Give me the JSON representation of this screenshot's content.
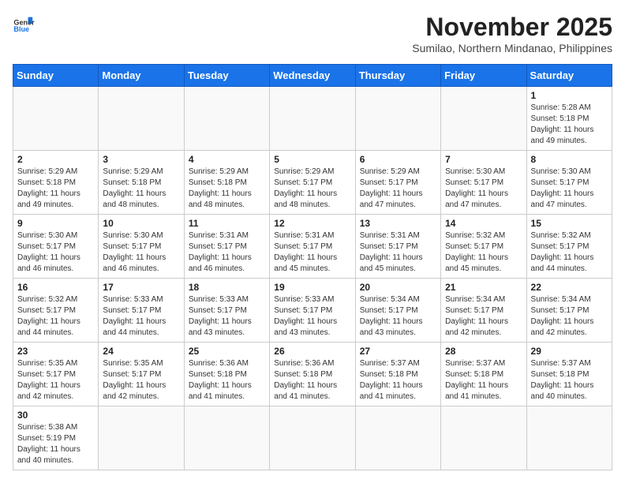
{
  "header": {
    "logo_general": "General",
    "logo_blue": "Blue",
    "month_title": "November 2025",
    "subtitle": "Sumilao, Northern Mindanao, Philippines"
  },
  "weekdays": [
    "Sunday",
    "Monday",
    "Tuesday",
    "Wednesday",
    "Thursday",
    "Friday",
    "Saturday"
  ],
  "weeks": [
    [
      {
        "day": "",
        "content": ""
      },
      {
        "day": "",
        "content": ""
      },
      {
        "day": "",
        "content": ""
      },
      {
        "day": "",
        "content": ""
      },
      {
        "day": "",
        "content": ""
      },
      {
        "day": "",
        "content": ""
      },
      {
        "day": "1",
        "content": "Sunrise: 5:28 AM\nSunset: 5:18 PM\nDaylight: 11 hours and 49 minutes."
      }
    ],
    [
      {
        "day": "2",
        "content": "Sunrise: 5:29 AM\nSunset: 5:18 PM\nDaylight: 11 hours and 49 minutes."
      },
      {
        "day": "3",
        "content": "Sunrise: 5:29 AM\nSunset: 5:18 PM\nDaylight: 11 hours and 48 minutes."
      },
      {
        "day": "4",
        "content": "Sunrise: 5:29 AM\nSunset: 5:18 PM\nDaylight: 11 hours and 48 minutes."
      },
      {
        "day": "5",
        "content": "Sunrise: 5:29 AM\nSunset: 5:17 PM\nDaylight: 11 hours and 48 minutes."
      },
      {
        "day": "6",
        "content": "Sunrise: 5:29 AM\nSunset: 5:17 PM\nDaylight: 11 hours and 47 minutes."
      },
      {
        "day": "7",
        "content": "Sunrise: 5:30 AM\nSunset: 5:17 PM\nDaylight: 11 hours and 47 minutes."
      },
      {
        "day": "8",
        "content": "Sunrise: 5:30 AM\nSunset: 5:17 PM\nDaylight: 11 hours and 47 minutes."
      }
    ],
    [
      {
        "day": "9",
        "content": "Sunrise: 5:30 AM\nSunset: 5:17 PM\nDaylight: 11 hours and 46 minutes."
      },
      {
        "day": "10",
        "content": "Sunrise: 5:30 AM\nSunset: 5:17 PM\nDaylight: 11 hours and 46 minutes."
      },
      {
        "day": "11",
        "content": "Sunrise: 5:31 AM\nSunset: 5:17 PM\nDaylight: 11 hours and 46 minutes."
      },
      {
        "day": "12",
        "content": "Sunrise: 5:31 AM\nSunset: 5:17 PM\nDaylight: 11 hours and 45 minutes."
      },
      {
        "day": "13",
        "content": "Sunrise: 5:31 AM\nSunset: 5:17 PM\nDaylight: 11 hours and 45 minutes."
      },
      {
        "day": "14",
        "content": "Sunrise: 5:32 AM\nSunset: 5:17 PM\nDaylight: 11 hours and 45 minutes."
      },
      {
        "day": "15",
        "content": "Sunrise: 5:32 AM\nSunset: 5:17 PM\nDaylight: 11 hours and 44 minutes."
      }
    ],
    [
      {
        "day": "16",
        "content": "Sunrise: 5:32 AM\nSunset: 5:17 PM\nDaylight: 11 hours and 44 minutes."
      },
      {
        "day": "17",
        "content": "Sunrise: 5:33 AM\nSunset: 5:17 PM\nDaylight: 11 hours and 44 minutes."
      },
      {
        "day": "18",
        "content": "Sunrise: 5:33 AM\nSunset: 5:17 PM\nDaylight: 11 hours and 43 minutes."
      },
      {
        "day": "19",
        "content": "Sunrise: 5:33 AM\nSunset: 5:17 PM\nDaylight: 11 hours and 43 minutes."
      },
      {
        "day": "20",
        "content": "Sunrise: 5:34 AM\nSunset: 5:17 PM\nDaylight: 11 hours and 43 minutes."
      },
      {
        "day": "21",
        "content": "Sunrise: 5:34 AM\nSunset: 5:17 PM\nDaylight: 11 hours and 42 minutes."
      },
      {
        "day": "22",
        "content": "Sunrise: 5:34 AM\nSunset: 5:17 PM\nDaylight: 11 hours and 42 minutes."
      }
    ],
    [
      {
        "day": "23",
        "content": "Sunrise: 5:35 AM\nSunset: 5:17 PM\nDaylight: 11 hours and 42 minutes."
      },
      {
        "day": "24",
        "content": "Sunrise: 5:35 AM\nSunset: 5:17 PM\nDaylight: 11 hours and 42 minutes."
      },
      {
        "day": "25",
        "content": "Sunrise: 5:36 AM\nSunset: 5:18 PM\nDaylight: 11 hours and 41 minutes."
      },
      {
        "day": "26",
        "content": "Sunrise: 5:36 AM\nSunset: 5:18 PM\nDaylight: 11 hours and 41 minutes."
      },
      {
        "day": "27",
        "content": "Sunrise: 5:37 AM\nSunset: 5:18 PM\nDaylight: 11 hours and 41 minutes."
      },
      {
        "day": "28",
        "content": "Sunrise: 5:37 AM\nSunset: 5:18 PM\nDaylight: 11 hours and 41 minutes."
      },
      {
        "day": "29",
        "content": "Sunrise: 5:37 AM\nSunset: 5:18 PM\nDaylight: 11 hours and 40 minutes."
      }
    ],
    [
      {
        "day": "30",
        "content": "Sunrise: 5:38 AM\nSunset: 5:19 PM\nDaylight: 11 hours and 40 minutes."
      },
      {
        "day": "",
        "content": ""
      },
      {
        "day": "",
        "content": ""
      },
      {
        "day": "",
        "content": ""
      },
      {
        "day": "",
        "content": ""
      },
      {
        "day": "",
        "content": ""
      },
      {
        "day": "",
        "content": ""
      }
    ]
  ]
}
